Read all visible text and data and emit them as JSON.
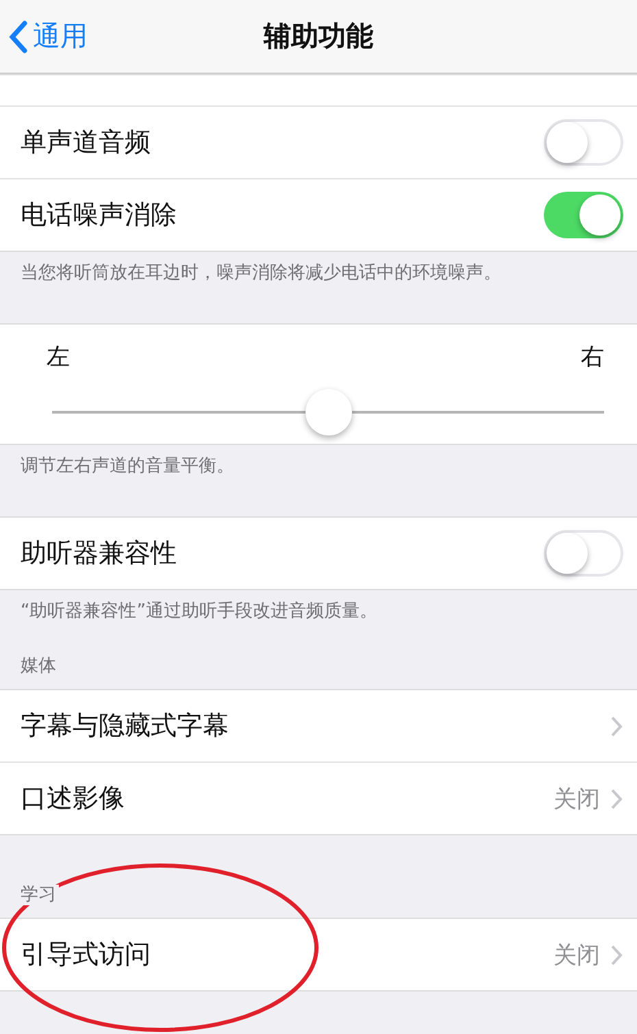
{
  "nav": {
    "back": "通用",
    "title": "辅助功能"
  },
  "sections": [
    {
      "kind": "list",
      "rows": [
        {
          "kind": "blank"
        },
        {
          "kind": "toggle",
          "label": "单声道音频",
          "on": false
        },
        {
          "kind": "toggle",
          "label": "电话噪声消除",
          "on": true
        }
      ],
      "footer": "当您将听筒放在耳边时，噪声消除将减少电话中的环境噪声。"
    },
    {
      "kind": "balance",
      "left": "左",
      "right": "右",
      "level": 0.5,
      "footer": "调节左右声道的音量平衡。"
    },
    {
      "kind": "list",
      "rows": [
        {
          "kind": "toggle",
          "label": "助听器兼容性",
          "on": false
        }
      ],
      "footer": "“助听器兼容性”通过助听手段改进音频质量。"
    },
    {
      "kind": "list",
      "header": "媒体",
      "rows": [
        {
          "kind": "link",
          "label": "字幕与隐藏式字幕"
        },
        {
          "kind": "link",
          "label": "口述影像",
          "value": "关闭"
        }
      ]
    },
    {
      "kind": "list",
      "header": "学习",
      "rows": [
        {
          "kind": "link",
          "label": "引导式访问",
          "value": "关闭"
        }
      ]
    }
  ]
}
